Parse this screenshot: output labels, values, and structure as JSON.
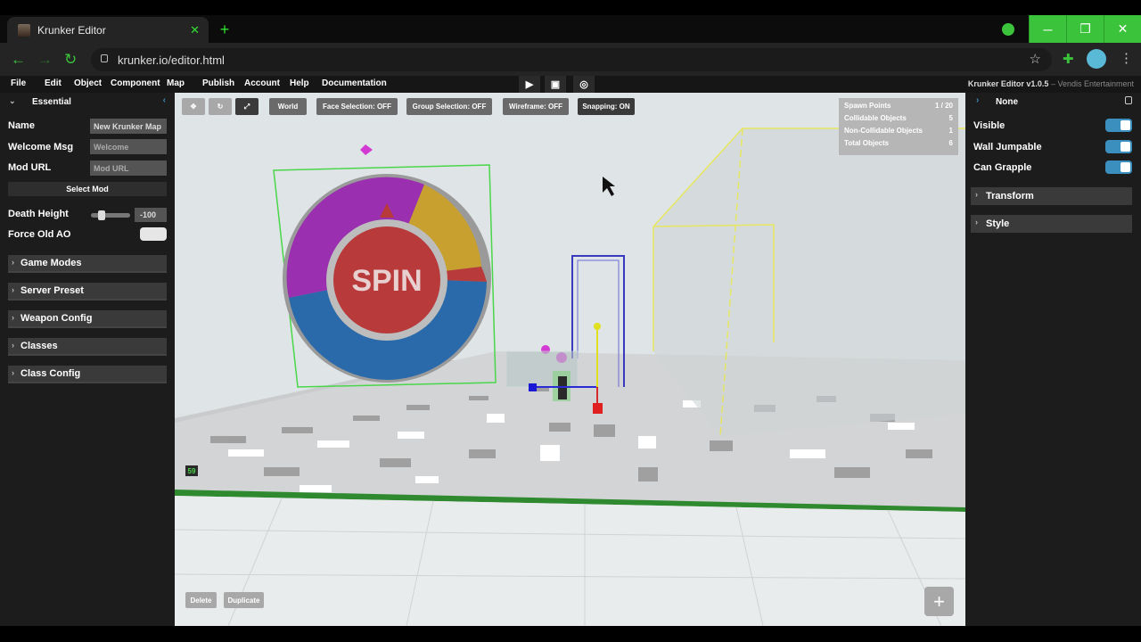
{
  "browser": {
    "tab_title": "Krunker Editor",
    "tab_close": "✕",
    "new_tab": "+",
    "url": "krunker.io/editor.html",
    "window_buttons": [
      "─",
      "❐",
      "✕"
    ]
  },
  "menubar": {
    "items": [
      "File",
      "Edit",
      "Object",
      "Component",
      "Map",
      "Publish",
      "Account",
      "Help",
      "Documentation"
    ],
    "title": "Krunker Editor v1.0.5",
    "vendor": " – Vendis Entertainment"
  },
  "left_panel": {
    "header": "Essential",
    "fields": [
      {
        "label": "Name",
        "value": "New Krunker Map",
        "placeholder": false
      },
      {
        "label": "Welcome Msg",
        "value": "Welcome",
        "placeholder": true
      },
      {
        "label": "Mod URL",
        "value": "Mod URL",
        "placeholder": true
      }
    ],
    "select_mod": "Select Mod",
    "death_height_label": "Death Height",
    "death_height_value": "-100",
    "force_old_ao_label": "Force Old AO",
    "sections": [
      "Game Modes",
      "Server Preset",
      "Weapon Config",
      "Classes",
      "Class Config"
    ]
  },
  "viewport": {
    "buttons": [
      "World",
      "Face Selection: OFF",
      "Group Selection: OFF",
      "Wireframe: OFF",
      "Snapping: ON"
    ],
    "stats": [
      {
        "label": "Spawn Points",
        "value": "1 / 20"
      },
      {
        "label": "Collidable Objects",
        "value": "5"
      },
      {
        "label": "Non-Collidable Objects",
        "value": "1"
      },
      {
        "label": "Total Objects",
        "value": "6"
      }
    ],
    "spin_text": "SPIN",
    "fps": "59",
    "delete": "Delete",
    "duplicate": "Duplicate",
    "add": "+"
  },
  "right_panel": {
    "header": "None",
    "toggles": [
      {
        "label": "Visible",
        "on": true
      },
      {
        "label": "Wall Jumpable",
        "on": true
      },
      {
        "label": "Can Grapple",
        "on": true
      }
    ],
    "sections": [
      "Transform",
      "Style"
    ]
  },
  "colors": {
    "accent": "#3cc33c",
    "toggle_on": "#3a8fbf",
    "wheel_purple": "#9a2fb0",
    "wheel_gold": "#c8a030",
    "wheel_blue": "#2a6aaa",
    "wheel_red": "#b83a3a"
  }
}
